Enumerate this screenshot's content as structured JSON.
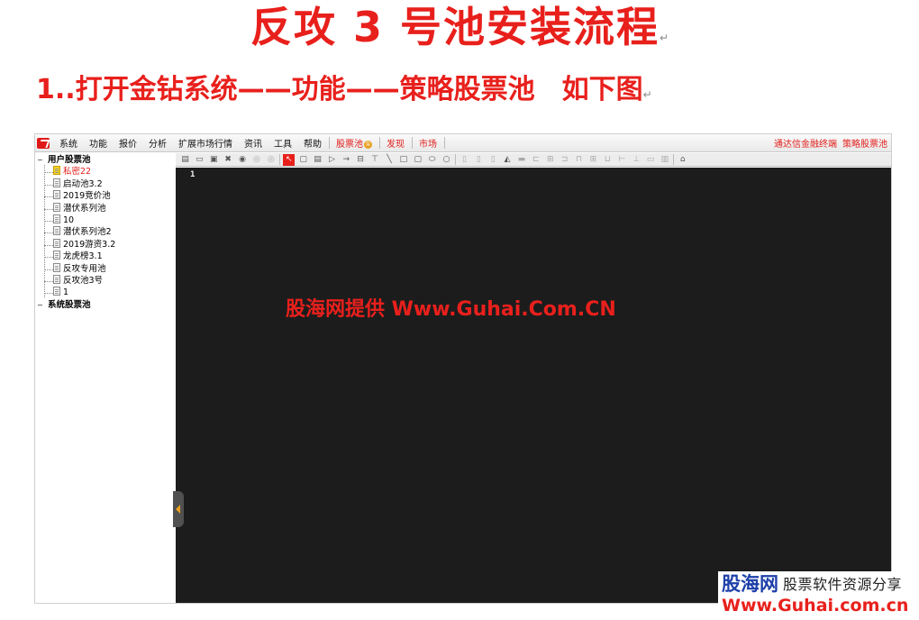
{
  "doc": {
    "title": "反攻 3 号池安装流程",
    "step1_text": "1..打开金钻系统——功能——策略股票池",
    "step1_suffix": "如下图",
    "pilcrow": "↵"
  },
  "menubar": {
    "items": [
      "系统",
      "功能",
      "报价",
      "分析",
      "扩展市场行情",
      "资讯",
      "工具",
      "帮助"
    ],
    "stock_pool": "股票池",
    "stock_pool_badge": "①",
    "discover": "发现",
    "market": "市场",
    "right_links": [
      "通达信金融终端",
      "策略股票池"
    ]
  },
  "tree": {
    "root_user": "用户股票池",
    "children": [
      "私密22",
      "启动池3.2",
      "2019竞价池",
      "潜伏系列池",
      "10",
      "潜伏系列池2",
      "2019游资3.2",
      "龙虎榜3.1",
      "反攻专用池",
      "反攻池3号",
      "1"
    ],
    "selected_index": 0,
    "root_system": "系统股票池",
    "expander": "−"
  },
  "toolbar": {
    "icons": [
      "new-icon",
      "open-icon",
      "save-icon",
      "delete-icon",
      "play-icon",
      "pause-icon",
      "stop-icon",
      "cursor-icon",
      "ellipse-icon",
      "rect-icon",
      "triangle-icon",
      "arrow-icon",
      "text-box-icon",
      "text-icon",
      "line-icon",
      "square-icon",
      "rounded-rect-icon",
      "diamond-icon",
      "circle-icon",
      "copy-icon",
      "paste-icon",
      "fill-icon",
      "color-icon",
      "line-style-icon",
      "align-left-icon",
      "align-center-icon",
      "align-right-icon",
      "align-top-icon",
      "align-middle-icon",
      "align-bottom-icon",
      "same-width-icon",
      "same-height-icon",
      "same-size-icon",
      "group-icon",
      "properties-icon"
    ],
    "selected_icon": "cursor-icon"
  },
  "editor": {
    "line_number": "1"
  },
  "watermark": {
    "text": "股海网提供 Www.Guhai.Com.CN"
  },
  "brand": {
    "name": "股海网",
    "tagline": "股票软件资源分享",
    "url": "Www.Guhai.com.cn"
  }
}
